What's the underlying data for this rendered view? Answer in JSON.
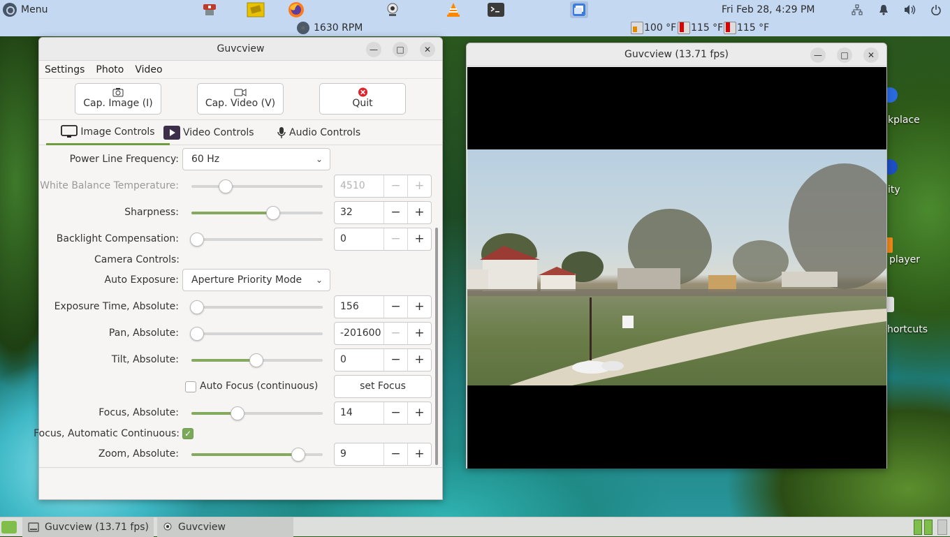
{
  "top_panel": {
    "menu_label": "Menu",
    "fan_readout": "1630 RPM",
    "clock": "Fri Feb 28,  4:29 PM",
    "temperatures": [
      "100 °F",
      "115 °F",
      "115 °F"
    ],
    "tray_icons": [
      "network-icon",
      "notification-bell-icon",
      "volume-icon",
      "power-icon"
    ]
  },
  "main_window": {
    "title": "Guvcview",
    "menu": [
      "Settings",
      "Photo",
      "Video"
    ],
    "buttons": {
      "cap_image": "Cap. Image (I)",
      "cap_video": "Cap. Video (V)",
      "quit": "Quit"
    },
    "tabs": [
      "Image Controls",
      "Video Controls",
      "Audio Controls"
    ],
    "controls": {
      "power_line_frequency": {
        "label": "Power Line Frequency:",
        "value": "60 Hz"
      },
      "white_balance_temperature": {
        "label": "White Balance Temperature:",
        "value": "4510",
        "slider_fraction": 0.24
      },
      "sharpness": {
        "label": "Sharpness:",
        "value": "32",
        "slider_fraction": 0.64
      },
      "backlight_compensation": {
        "label": "Backlight Compensation:",
        "value": "0",
        "slider_fraction": 0.0
      },
      "camera_controls_heading": "Camera Controls:",
      "auto_exposure": {
        "label": "Auto Exposure:",
        "value": "Aperture Priority Mode"
      },
      "exposure_time_absolute": {
        "label": "Exposure Time, Absolute:",
        "value": "156",
        "slider_fraction": 0.0
      },
      "pan_absolute": {
        "label": "Pan, Absolute:",
        "value": "-201600",
        "slider_fraction": 0.0
      },
      "tilt_absolute": {
        "label": "Tilt, Absolute:",
        "value": "0",
        "slider_fraction": 0.5
      },
      "auto_focus_continuous": {
        "label": "Auto Focus (continuous)",
        "checked": false
      },
      "set_focus_button": "set Focus",
      "focus_absolute": {
        "label": "Focus, Absolute:",
        "value": "14",
        "slider_fraction": 0.34
      },
      "focus_automatic_continuous": {
        "label": "Focus, Automatic Continuous:",
        "checked": true
      },
      "zoom_absolute": {
        "label": "Zoom, Absolute:",
        "value": "9",
        "slider_fraction": 0.85
      }
    }
  },
  "preview_window": {
    "title": "Guvcview  (13.71 fps)"
  },
  "desktop_labels": [
    "kplace",
    "ity",
    "player",
    "hortcuts"
  ],
  "taskbar": {
    "items": [
      "Guvcview (13.71 fps)",
      "Guvcview"
    ]
  },
  "colors": {
    "accent_green": "#6d9d3f",
    "panel_blue": "#c4d8f1",
    "quit_red": "#e0222a"
  }
}
